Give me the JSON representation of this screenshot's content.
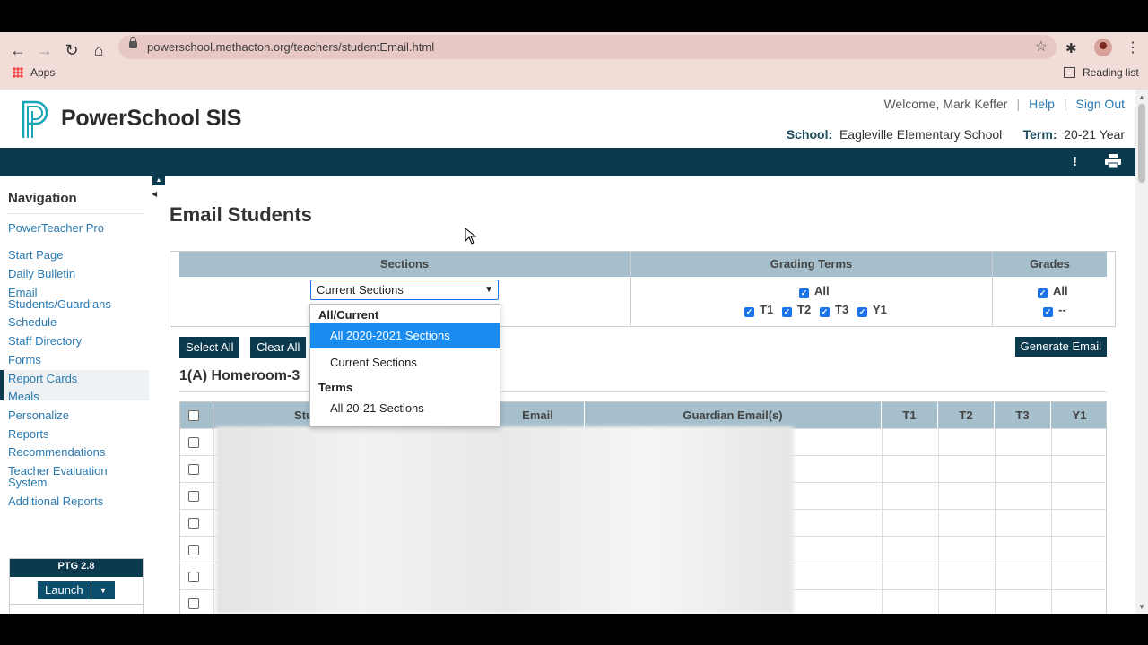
{
  "browser": {
    "url": "powerschool.methacton.org/teachers/studentEmail.html",
    "bookmarks": {
      "apps": "Apps",
      "reading_list": "Reading list"
    }
  },
  "header": {
    "logo_text": "PowerSchool SIS",
    "welcome": "Welcome, Mark Keffer",
    "help": "Help",
    "sign_out": "Sign Out",
    "school_label": "School:",
    "school_value": "Eagleville Elementary School",
    "term_label": "Term:",
    "term_value": "20-21 Year",
    "alert_icon": "!",
    "print_icon": "print-icon"
  },
  "navigation": {
    "title": "Navigation",
    "items": [
      "PowerTeacher Pro",
      "Start Page",
      "Daily Bulletin",
      "Email Students/Guardians",
      "Schedule",
      "Staff Directory",
      "Forms",
      "Report Cards",
      "Meals",
      "Personalize",
      "Reports",
      "Recommendations",
      "Teacher Evaluation System",
      "Additional Reports"
    ],
    "ptg": {
      "title": "PTG 2.8",
      "launch": "Launch"
    }
  },
  "main": {
    "title": "Email Students",
    "filter": {
      "sections_header": "Sections",
      "terms_header": "Grading Terms",
      "grades_header": "Grades",
      "selected_section": "Current Sections",
      "terms": [
        "All",
        "T1",
        "T2",
        "T3",
        "Y1"
      ],
      "grades": [
        "All",
        "--"
      ]
    },
    "buttons": {
      "select_all": "Select All",
      "clear_all": "Clear All",
      "generate_email": "Generate Email"
    },
    "section_title": "1(A) Homeroom-3",
    "table": {
      "headers": [
        "Stud",
        "Email",
        "Guardian Email(s)",
        "T1",
        "T2",
        "T3",
        "Y1"
      ],
      "row_count": 7
    },
    "dropdown": {
      "group1": "All/Current",
      "options1": [
        "All 2020-2021 Sections",
        "Current Sections"
      ],
      "group2": "Terms",
      "options2": [
        "All 20-21 Sections"
      ],
      "highlighted": "All 2020-2021 Sections"
    }
  }
}
